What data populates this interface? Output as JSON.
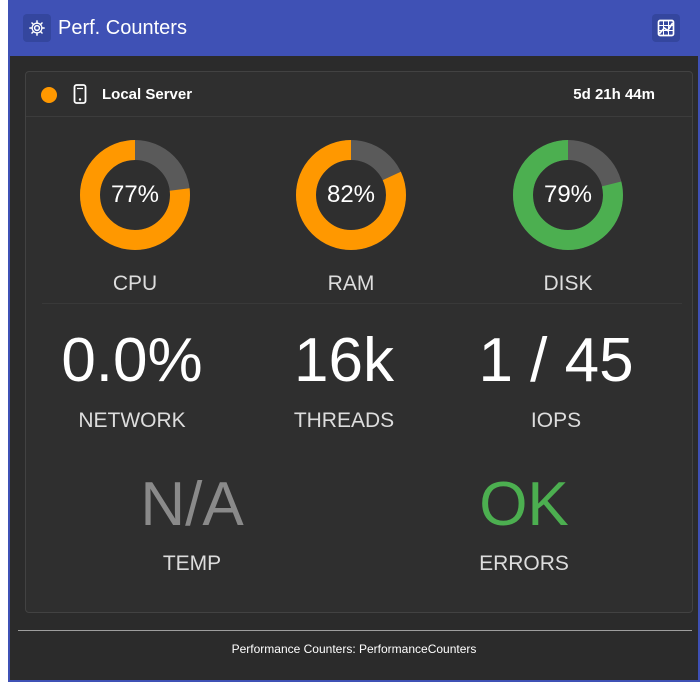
{
  "header": {
    "title": "Perf. Counters",
    "settings_icon": "gear-icon",
    "chart_icon": "chart-grid-icon"
  },
  "server": {
    "name": "Local Server",
    "status_color": "#ff9800",
    "device_icon": "mobile-device-icon",
    "uptime": "5d 21h 44m"
  },
  "gauges": [
    {
      "label": "CPU",
      "value": "77%",
      "percent": 77,
      "color": "#ff9800"
    },
    {
      "label": "RAM",
      "value": "82%",
      "percent": 82,
      "color": "#ff9800"
    },
    {
      "label": "DISK",
      "value": "79%",
      "percent": 79,
      "color": "#4caf50"
    }
  ],
  "metrics": [
    {
      "label": "NETWORK",
      "value": "0.0%"
    },
    {
      "label": "THREADS",
      "value": "16k"
    },
    {
      "label": "IOPS",
      "value": "1 / 45"
    }
  ],
  "status": [
    {
      "label": "TEMP",
      "value": "N/A",
      "color": "#8a8a8a"
    },
    {
      "label": "ERRORS",
      "value": "OK",
      "color": "#4caf50"
    }
  ],
  "colors": {
    "header": "#3f51b5",
    "background": "#2b2b2b",
    "gauge_track": "#5a5a5a"
  },
  "footer": {
    "text": "Performance Counters: PerformanceCounters"
  }
}
